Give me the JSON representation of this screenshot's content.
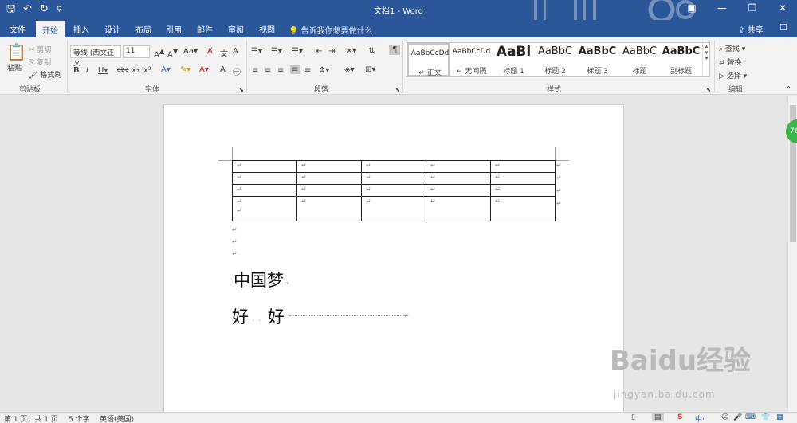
{
  "window": {
    "title": "文档1 - Word",
    "qat": {
      "save_icon": "save-icon",
      "undo_icon": "undo-icon",
      "redo_icon": "redo-icon",
      "customize_icon": "customize-qat-icon"
    },
    "controls": [
      "ribbon-display-icon",
      "minimize-icon",
      "maximize-icon",
      "close-icon"
    ]
  },
  "tabs": [
    "文件",
    "开始",
    "插入",
    "设计",
    "布局",
    "引用",
    "邮件",
    "审阅",
    "视图"
  ],
  "active_tab": "开始",
  "tell_me": "告诉我你想要做什么",
  "share": "共享",
  "ribbon": {
    "clipboard": {
      "paste": "粘贴",
      "cut": "剪切",
      "copy": "复制",
      "format_painter": "格式刷",
      "label": "剪贴板"
    },
    "font": {
      "font_name": "等线 (西文正文",
      "font_size": "11",
      "label": "字体"
    },
    "paragraph": {
      "label": "段落"
    },
    "styles": {
      "label": "样式",
      "items": [
        {
          "sample": "AaBbCcDd",
          "name": "正文"
        },
        {
          "sample": "AaBbCcDd",
          "name": "无间隔"
        },
        {
          "sample": "AaBl",
          "name": "标题 1"
        },
        {
          "sample": "AaBbC",
          "name": "标题 2"
        },
        {
          "sample": "AaBbC",
          "name": "标题 3"
        },
        {
          "sample": "AaBbC",
          "name": "标题"
        },
        {
          "sample": "AaBbC",
          "name": "副标题"
        }
      ]
    },
    "editing": {
      "find": "查找",
      "replace": "替换",
      "select": "选择",
      "label": "编辑"
    }
  },
  "document": {
    "table": {
      "rows": 4,
      "cols": 5,
      "cell_mark": "↵"
    },
    "heading_text": "中国梦",
    "second_line_left": "好",
    "second_line_right": "好",
    "para_mark": "↵"
  },
  "status_bar": {
    "page": "第 1 页，共 1 页",
    "words": "5 个字",
    "language": "英语(美国)"
  },
  "badge": "76",
  "watermark": {
    "logo": "Baidu经验",
    "url": "jingyan.baidu.com"
  }
}
